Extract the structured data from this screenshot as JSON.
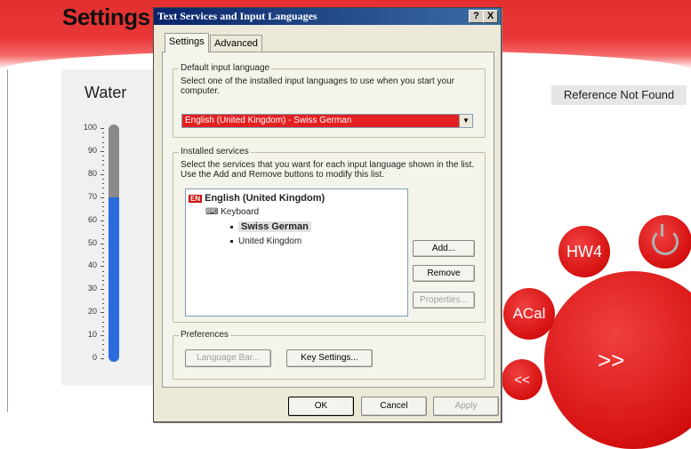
{
  "app": {
    "title": "Settings",
    "water_panel": {
      "title": "Water",
      "level_percent": 70,
      "scale": {
        "min": 0,
        "max": 100,
        "ticks": [
          "100",
          "90",
          "80",
          "70",
          "60",
          "50",
          "40",
          "30",
          "20",
          "10",
          "0"
        ]
      }
    },
    "reference_text": "Reference Not Found",
    "circles": {
      "hw4": "HW4",
      "acal": "ACal",
      "next": ">>",
      "prev": "<<"
    }
  },
  "dialog": {
    "title": "Text Services and Input Languages",
    "help_button": "?",
    "close_button": "X",
    "tabs": [
      {
        "label": "Settings",
        "active": true
      },
      {
        "label": "Advanced",
        "active": false
      }
    ],
    "default_language": {
      "group_label": "Default input language",
      "description": "Select one of the installed input languages to use when you start your computer.",
      "selected": "English (United Kingdom) - Swiss German"
    },
    "installed_services": {
      "group_label": "Installed services",
      "description": "Select the services that you want for each input language shown in the list. Use the Add and Remove buttons to modify this list.",
      "language_code": "EN",
      "language": "English (United Kingdom)",
      "category": "Keyboard",
      "layouts": [
        "Swiss German",
        "United Kingdom"
      ],
      "buttons": {
        "add": "Add...",
        "remove": "Remove",
        "properties": "Properties..."
      }
    },
    "preferences": {
      "group_label": "Preferences",
      "language_bar": "Language Bar...",
      "key_settings": "Key Settings..."
    },
    "footer": {
      "ok": "OK",
      "cancel": "Cancel",
      "apply": "Apply"
    }
  }
}
